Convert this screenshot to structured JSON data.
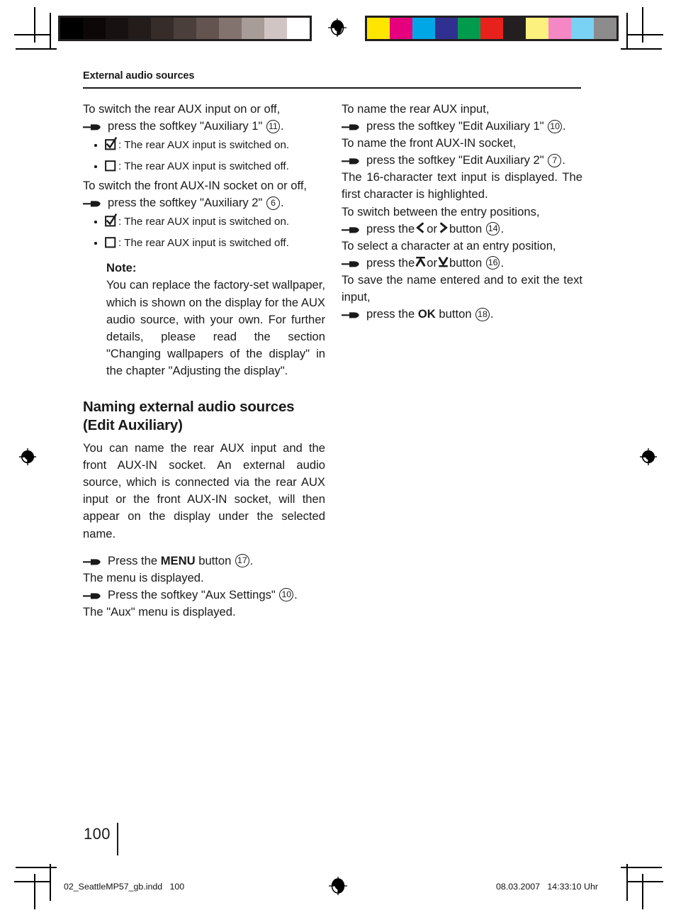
{
  "document": {
    "running_head": "External audio sources",
    "folio": "100"
  },
  "marks": {
    "registration_icon": "registration-target-icon",
    "hand_icon": "pointing-hand-icon",
    "checkbox_on_icon": "checkbox-checked-icon",
    "checkbox_off_icon": "checkbox-empty-icon",
    "left_arrow_icon": "chevron-left-icon",
    "right_arrow_icon": "chevron-right-icon",
    "up_arrow_icon": "arrow-up-bar-icon",
    "down_arrow_icon": "arrow-down-bar-icon"
  },
  "color_bars": {
    "grayscale": [
      "#000000",
      "#0b0807",
      "#171211",
      "#231c1a",
      "#362c29",
      "#4b3f3c",
      "#635450",
      "#83736e",
      "#a89c98",
      "#d0c5c3",
      "#ffffff"
    ],
    "color": [
      "#ffe600",
      "#e6007e",
      "#00a7e7",
      "#303091",
      "#009b4d",
      "#e8211c",
      "#231f20",
      "#fcf07e",
      "#f588c4",
      "#79d2f4",
      "#8c8c8c"
    ]
  },
  "left_column": {
    "intro_1": "To switch the rear AUX input on or off,",
    "step_1": {
      "pre": "press the softkey \"Auxiliary 1\"",
      "ref": "11",
      "post": "."
    },
    "state_on_1": ": The rear AUX input is switched on.",
    "state_off_1": ": The rear AUX input is switched off.",
    "intro_2": "To switch the front AUX-IN socket on or off,",
    "step_2": {
      "pre": "press the softkey \"Auxiliary 2\"",
      "ref": "6",
      "post": "."
    },
    "state_on_2": ": The rear AUX input is switched on.",
    "state_off_2": ": The rear AUX input is switched off.",
    "note_title": "Note:",
    "note_body": "You can replace the factory-set wallpaper, which is shown on the display for the AUX audio source, with your own. For further details, please read the section \"Changing wallpapers of the display\" in the chapter \"Adjusting the display\".",
    "section_heading_line1": "Naming external audio sources",
    "section_heading_line2": "(Edit Auxiliary)",
    "section_body": "You can name the rear AUX input and the front AUX-IN socket. An external audio source, which is connected via the rear AUX input or the front AUX-IN socket, will then appear on the display under the selected name.",
    "step_menu": {
      "pre": "Press the",
      "bold": "MENU",
      "mid": "button",
      "ref": "17",
      "post": "."
    },
    "result_menu": "The menu is displayed.",
    "step_aux": {
      "pre": "Press the softkey \"Aux Settings\"",
      "ref": "10",
      "post": "."
    },
    "result_aux": "The \"Aux\" menu is displayed."
  },
  "right_column": {
    "intro_1": "To name the rear AUX input,",
    "step_1": {
      "pre": "press the softkey \"Edit Auxiliary 1\"",
      "ref": "10",
      "post": "."
    },
    "intro_2": "To name the front AUX-IN socket,",
    "step_2": {
      "pre": "press the softkey \"Edit Auxiliary 2\"",
      "ref": "7",
      "post": "."
    },
    "body_1": "The 16-character text input is displayed. The first character is highlighted.",
    "intro_3": "To switch between the entry positions,",
    "step_3": {
      "pre": "press the",
      "mid": "or",
      "post_label": "button",
      "ref": "14",
      "post": "."
    },
    "intro_4": "To select a character at an entry position,",
    "step_4": {
      "pre": "press the",
      "mid": "or",
      "post_label": "button",
      "ref": "16",
      "post": "."
    },
    "intro_5": "To save the name entered and to exit the text input,",
    "step_5": {
      "pre": "press the",
      "bold": "OK",
      "mid": "button",
      "ref": "18",
      "post": "."
    }
  },
  "footer": {
    "file_slug": "02_SeattleMP57_gb.indd   100",
    "timestamp": "08.03.2007   14:33:10 Uhr"
  }
}
